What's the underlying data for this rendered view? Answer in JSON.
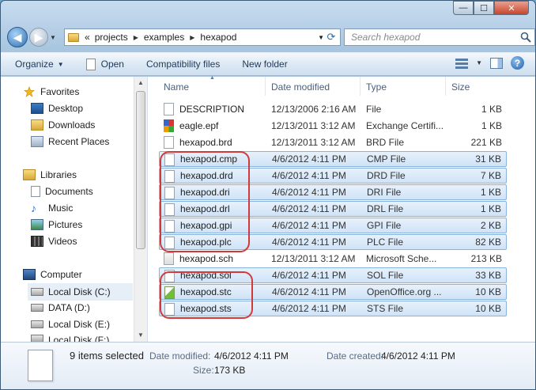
{
  "window": {
    "caption": {
      "min": "—",
      "max": "☐",
      "close": "✕"
    }
  },
  "address": {
    "prefix": "«",
    "crumbs": [
      "projects",
      "examples",
      "hexapod"
    ],
    "search_placeholder": "Search hexapod"
  },
  "toolbar": {
    "organize": "Organize",
    "open": "Open",
    "compat": "Compatibility files",
    "new_folder": "New folder"
  },
  "nav": {
    "favorites": "Favorites",
    "desktop": "Desktop",
    "downloads": "Downloads",
    "recent": "Recent Places",
    "libraries": "Libraries",
    "documents": "Documents",
    "music": "Music",
    "pictures": "Pictures",
    "videos": "Videos",
    "computer": "Computer",
    "local_c": "Local Disk (C:)",
    "data_d": "DATA (D:)",
    "local_e": "Local Disk (E:)",
    "local_f": "Local Disk (F:)"
  },
  "columns": {
    "name": "Name",
    "date": "Date modified",
    "type": "Type",
    "size": "Size"
  },
  "files": [
    {
      "name": "DESCRIPTION",
      "date": "12/13/2006 2:16 AM",
      "type": "File",
      "size": "1 KB",
      "selected": false
    },
    {
      "name": "eagle.epf",
      "date": "12/13/2011 3:12 AM",
      "type": "Exchange Certifi...",
      "size": "1 KB",
      "selected": false
    },
    {
      "name": "hexapod.brd",
      "date": "12/13/2011 3:12 AM",
      "type": "BRD File",
      "size": "221 KB",
      "selected": false
    },
    {
      "name": "hexapod.cmp",
      "date": "4/6/2012 4:11 PM",
      "type": "CMP File",
      "size": "31 KB",
      "selected": true
    },
    {
      "name": "hexapod.drd",
      "date": "4/6/2012 4:11 PM",
      "type": "DRD File",
      "size": "7 KB",
      "selected": true
    },
    {
      "name": "hexapod.dri",
      "date": "4/6/2012 4:11 PM",
      "type": "DRI File",
      "size": "1 KB",
      "selected": true
    },
    {
      "name": "hexapod.drl",
      "date": "4/6/2012 4:11 PM",
      "type": "DRL File",
      "size": "1 KB",
      "selected": true
    },
    {
      "name": "hexapod.gpi",
      "date": "4/6/2012 4:11 PM",
      "type": "GPI File",
      "size": "2 KB",
      "selected": true
    },
    {
      "name": "hexapod.plc",
      "date": "4/6/2012 4:11 PM",
      "type": "PLC File",
      "size": "82 KB",
      "selected": true
    },
    {
      "name": "hexapod.sch",
      "date": "12/13/2011 3:12 AM",
      "type": "Microsoft Sche...",
      "size": "213 KB",
      "selected": false
    },
    {
      "name": "hexapod.sol",
      "date": "4/6/2012 4:11 PM",
      "type": "SOL File",
      "size": "33 KB",
      "selected": true
    },
    {
      "name": "hexapod.stc",
      "date": "4/6/2012 4:11 PM",
      "type": "OpenOffice.org ...",
      "size": "10 KB",
      "selected": true
    },
    {
      "name": "hexapod.sts",
      "date": "4/6/2012 4:11 PM",
      "type": "STS File",
      "size": "10 KB",
      "selected": true
    }
  ],
  "details": {
    "count": "9 items selected",
    "modified_label": "Date modified:",
    "modified_value": "4/6/2012 4:11 PM",
    "created_label": "Date created:",
    "created_value": "4/6/2012 4:11 PM",
    "size_label": "Size:",
    "size_value": "173 KB"
  },
  "colors": {
    "selection": "#cfe3f7",
    "annotation": "#d03a3a"
  }
}
